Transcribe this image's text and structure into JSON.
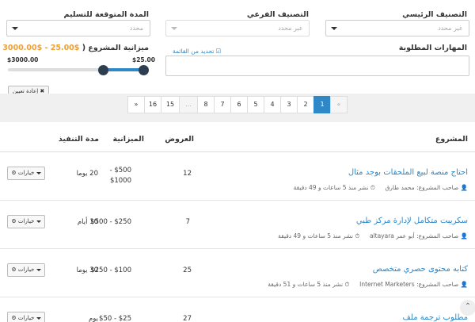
{
  "filters": {
    "main_category": {
      "label": "التصنيف الرئيسي",
      "placeholder": "غير محدد"
    },
    "sub_category": {
      "label": "التصنيف الفرعي",
      "placeholder": "غير محدد"
    },
    "delivery": {
      "label": "المدة المتوقعة للتسليم",
      "placeholder": "محدد"
    },
    "skills": {
      "label": "المهارات المطلوبة"
    },
    "select_from_list": "☑ تحديد من القائمة",
    "budget": {
      "label": "ميزانية المشروع (",
      "range_text": "$25.00 - $3000.00",
      "close_paren": ")",
      "max_label": "$3000.00",
      "min_label": "$25.00",
      "min_value": 25,
      "max_value": 3000
    },
    "reset_label": "إعادة تعيين"
  },
  "pagination": [
    "«",
    "1",
    "2",
    "3",
    "4",
    "5",
    "6",
    "7",
    "8",
    "...",
    "15",
    "16",
    "»"
  ],
  "table": {
    "headers": {
      "project": "المشروع",
      "offers": "العروض",
      "budget": "الميزانية",
      "duration": "مدة التنفيذ"
    },
    "options_label": "خيارات",
    "rows": [
      {
        "title": "احتاج منصة لبيع الملحقات بوجد مثال",
        "owner_prefix": "صاحب المشروع:",
        "owner": "محمد طارق",
        "time": "نشر منذ 5 ساعات و 49 دقيقة",
        "offers": "12",
        "budget_line1": "$500 -",
        "budget_line2": "$1000",
        "duration": "20 يوما"
      },
      {
        "title": "سكريبت متكامل لإدارة مركز طبي",
        "owner_prefix": "صاحب المشروع:",
        "owner": "أبو عمر altayara",
        "time": "نشر منذ 5 ساعات و 49 دقيقة",
        "offers": "7",
        "budget_line1": "$250 - $500",
        "budget_line2": "",
        "duration": "10 أيام"
      },
      {
        "title": "كتابه محتوى حصري متخصص",
        "owner_prefix": "صاحب المشروع:",
        "owner": "Internet Marketers",
        "time": "نشر منذ 5 ساعات و 51 دقيقة",
        "offers": "25",
        "budget_line1": "$100 - $250",
        "budget_line2": "",
        "duration": "30 يوما"
      },
      {
        "title": "مطلوب ترجمة ملف",
        "owner_prefix": "",
        "owner": "",
        "time": "",
        "offers": "27",
        "budget_line1": "$25 - $50",
        "budget_line2": "",
        "duration": "يوم"
      }
    ]
  },
  "scroll_top_icon": "chevron-up-icon"
}
